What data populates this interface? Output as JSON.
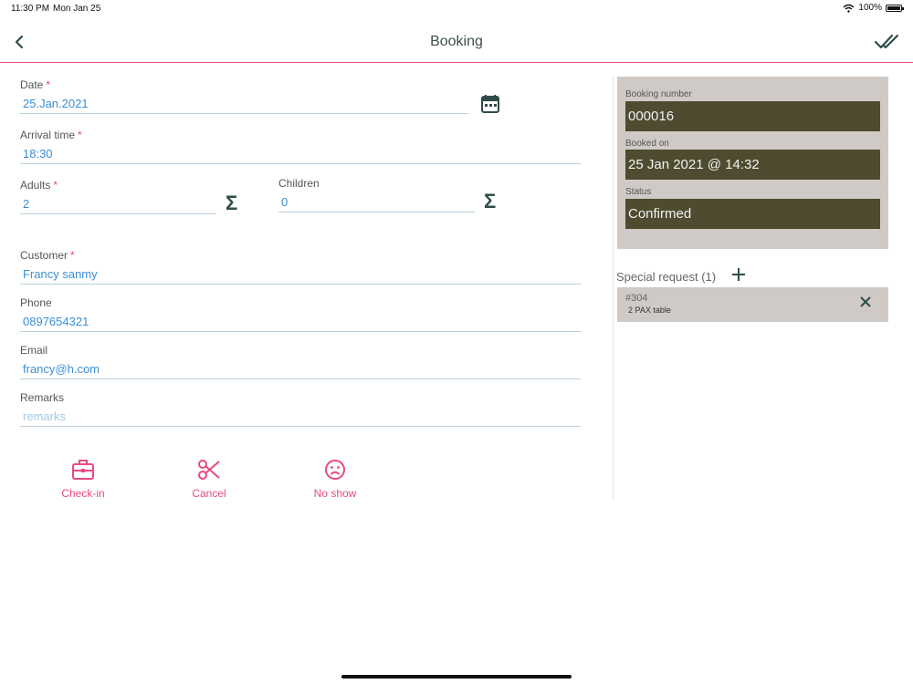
{
  "status_bar": {
    "time": "11:30 PM",
    "date": "Mon Jan 25",
    "battery": "100%"
  },
  "nav": {
    "title": "Booking"
  },
  "form": {
    "date": {
      "label": "Date",
      "required": "*",
      "value": "25.Jan.2021"
    },
    "arrival": {
      "label": "Arrival time",
      "required": "*",
      "value": "18:30"
    },
    "adults": {
      "label": "Adults",
      "required": "*",
      "value": "2"
    },
    "children": {
      "label": "Children",
      "value": "0"
    },
    "customer": {
      "label": "Customer",
      "required": "*",
      "value": "Francy sanmy"
    },
    "phone": {
      "label": "Phone",
      "value": "0897654321"
    },
    "email": {
      "label": "Email",
      "value": "francy@h.com"
    },
    "remarks": {
      "label": "Remarks",
      "placeholder": "remarks"
    },
    "sigma": "Σ"
  },
  "actions": {
    "checkin": "Check-in",
    "cancel": "Cancel",
    "noshow": "No show"
  },
  "info": {
    "booking_number_label": "Booking number",
    "booking_number": "000016",
    "booked_on_label": "Booked on",
    "booked_on": "25 Jan 2021 @ 14:32",
    "status_label": "Status",
    "status": "Confirmed"
  },
  "special_requests": {
    "header": "Special request (1)",
    "items": [
      {
        "number": "#304",
        "description": "2 PAX table"
      }
    ]
  },
  "colors": {
    "accent": "#e64a86",
    "dark": "#4e4b30",
    "panel": "#d0cac6",
    "value_text": "#3b8fd6"
  }
}
